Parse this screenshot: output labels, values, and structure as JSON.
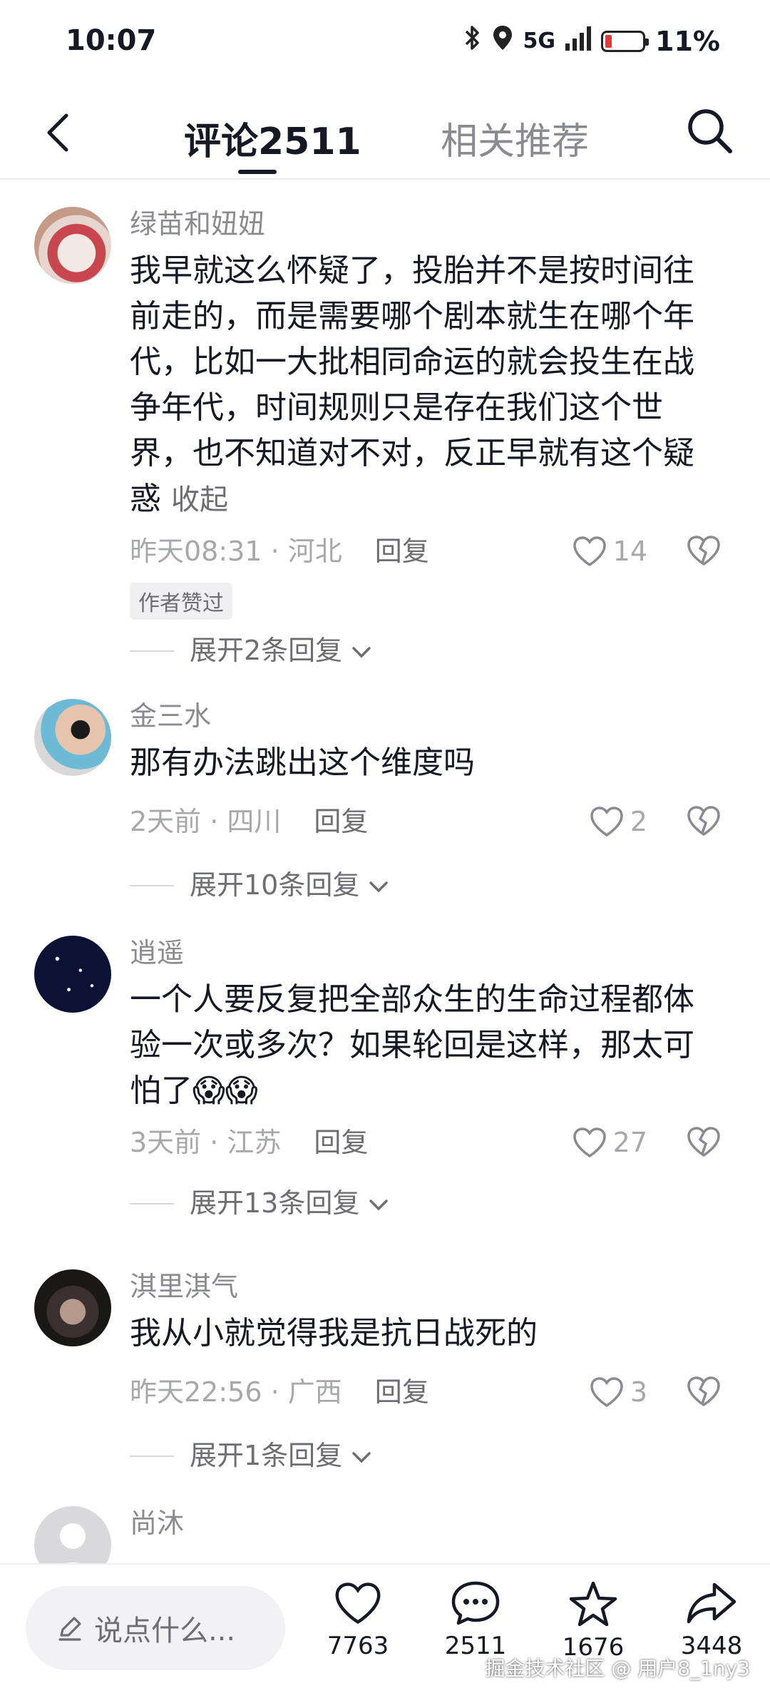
{
  "status_bar": {
    "time": "10:07",
    "network": "5G",
    "battery": "11%"
  },
  "header": {
    "tab_comments": "评论2511",
    "tab_related": "相关推荐"
  },
  "comments": [
    {
      "user": "绿苗和妞妞",
      "text": "我早就这么怀疑了，投胎并不是按时间往前走的，而是需要哪个剧本就生在哪个年代，比如一大批相同命运的就会投生在战争年代，时间规则只是存在我们这个世界，也不知道对不对，反正早就有这个疑惑",
      "collapse": "收起",
      "time_loc": "昨天08:31 · 河北",
      "reply": "回复",
      "likes": "14",
      "badge": "作者赞过",
      "expand": "展开2条回复"
    },
    {
      "user": "金三水",
      "text": "那有办法跳出这个维度吗",
      "time_loc": "2天前 · 四川",
      "reply": "回复",
      "likes": "2",
      "expand": "展开10条回复"
    },
    {
      "user": "逍遥",
      "text": "一个人要反复把全部众生的生命过程都体验一次或多次？如果轮回是这样，那太可怕了😱😱",
      "time_loc": "3天前 · 江苏",
      "reply": "回复",
      "likes": "27",
      "expand": "展开13条回复"
    },
    {
      "user": "淇里淇气",
      "text": "我从小就觉得我是抗日战死的",
      "time_loc": "昨天22:56 · 广西",
      "reply": "回复",
      "likes": "3",
      "expand": "展开1条回复"
    },
    {
      "user": "尚沐"
    }
  ],
  "bottom_bar": {
    "placeholder": "说点什么...",
    "likes": "7763",
    "comments": "2511",
    "favorites": "1676",
    "shares": "3448"
  },
  "watermark": "掘金技术社区 @ 用户8_1ny3",
  "colors": {
    "text": "#161823",
    "secondary": "#8a8b91",
    "battery_low": "#e53935"
  }
}
